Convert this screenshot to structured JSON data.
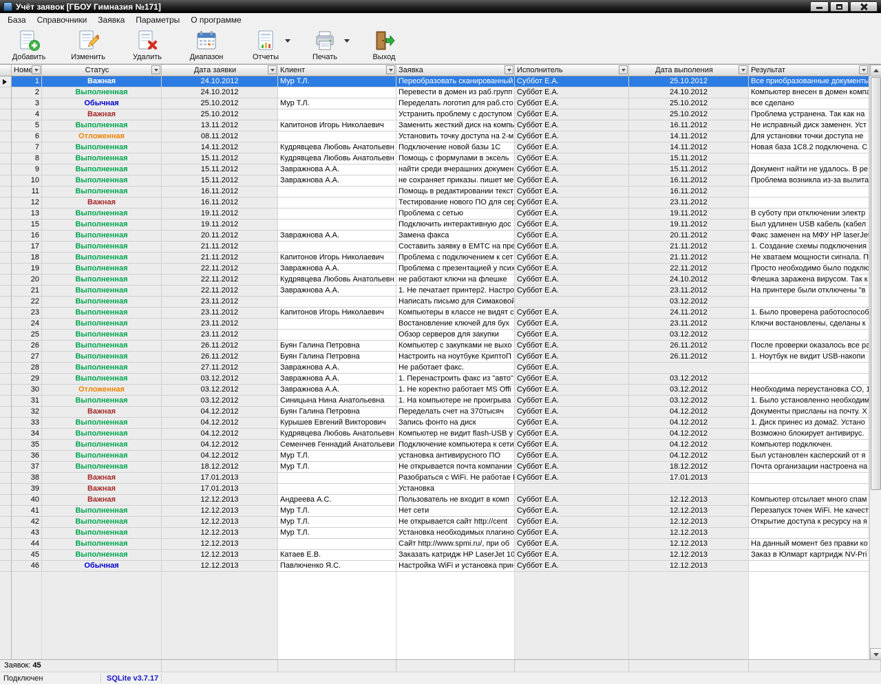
{
  "window": {
    "title": "Учёт заявок [ГБОУ Гимназия №171]"
  },
  "menu": [
    {
      "id": "db",
      "label": "База"
    },
    {
      "id": "references",
      "label": "Справочники"
    },
    {
      "id": "request",
      "label": "Заявка"
    },
    {
      "id": "parameters",
      "label": "Параметры"
    },
    {
      "id": "about",
      "label": "О программе"
    }
  ],
  "toolbar": [
    {
      "id": "add",
      "icon": "add-document",
      "label": "Добавить"
    },
    {
      "id": "edit",
      "icon": "edit-document",
      "label": "Изменить"
    },
    {
      "id": "delete",
      "icon": "delete-document",
      "label": "Удалить"
    },
    {
      "id": "range",
      "icon": "calendar-range",
      "label": "Диапазон"
    },
    {
      "id": "reports",
      "icon": "report-document",
      "label": "Отчеты",
      "dropdown": true
    },
    {
      "id": "print",
      "icon": "printer",
      "label": "Печать",
      "dropdown": true
    },
    {
      "id": "exit",
      "icon": "exit-door",
      "label": "Выход"
    }
  ],
  "colors": {
    "selection": "#2c7ce4",
    "db_version_text": "#1a17c9"
  },
  "status_colors": {
    "Важная": "#a52a2a",
    "Выполненная": "#00a651",
    "Обычная": "#0000cd",
    "Отложенная": "#ef8200"
  },
  "grid": {
    "selected_index": 0,
    "columns": [
      {
        "id": "number",
        "label": "Номер",
        "halign": "left"
      },
      {
        "id": "status",
        "label": "Статус",
        "halign": "center"
      },
      {
        "id": "request-date",
        "label": "Дата заявки",
        "halign": "center"
      },
      {
        "id": "client",
        "label": "Клиент",
        "halign": "left"
      },
      {
        "id": "request",
        "label": "Заявка",
        "halign": "left"
      },
      {
        "id": "executor",
        "label": "Исполнитель",
        "halign": "left"
      },
      {
        "id": "completion-date",
        "label": "Дата выполения",
        "halign": "center"
      },
      {
        "id": "result",
        "label": "Результат",
        "halign": "left"
      }
    ],
    "rows": [
      [
        "1",
        "Важная",
        "24.10.2012",
        "Мур Т.Л.",
        "Переобразовать сканированный",
        "Суббот Е.А.",
        "25.10.2012",
        "Все приобразованные документы"
      ],
      [
        "2",
        "Выполненная",
        "24.10.2012",
        "",
        "Перевести в домен из раб.групп",
        "Суббот Е.А.",
        "24.10.2012",
        "Компьютер внесен в домен компа"
      ],
      [
        "3",
        "Обычная",
        "25.10.2012",
        "Мур Т.Л.",
        "Переделать логотип для раб.сто",
        "Суббот Е.А.",
        "25.10.2012",
        "все сделано"
      ],
      [
        "4",
        "Важная",
        "25.10.2012",
        "",
        "Устранить проблему с доступом",
        "Суббот Е.А.",
        "25.10.2012",
        "Проблема устранена. Так как на"
      ],
      [
        "5",
        "Выполненная",
        "13.11.2012",
        "Капитонов Игорь Николаевич",
        "Заменить жесткий диск на компь",
        "Суббот Е.А.",
        "16.11.2012",
        "Не исправный диск заменен. Уст"
      ],
      [
        "6",
        "Отложенная",
        "08.11.2012",
        "",
        "Установить точку доступа на 2-м",
        "Суббот Е.А.",
        "14.11.2012",
        "Для установки точки доступа не"
      ],
      [
        "7",
        "Выполненная",
        "14.11.2012",
        "Кудрявцева Любовь Анатольевн",
        "Подключение новой базы 1С",
        "Суббот Е.А.",
        "14.11.2012",
        "Новая база 1С8.2 подключена. С"
      ],
      [
        "8",
        "Выполненная",
        "15.11.2012",
        "Кудрявцева Любовь Анатольевн",
        "Помощь с формулами в эксель",
        "Суббот Е.А.",
        "15.11.2012",
        ""
      ],
      [
        "9",
        "Выполненная",
        "15.11.2012",
        "Завражнова А.А.",
        "найти среди вчерашних докумен",
        "Суббот Е.А.",
        "15.11.2012",
        "Документ найти не удалось. В ре"
      ],
      [
        "10",
        "Выполненная",
        "15.11.2012",
        "Завражнова А.А.",
        "не сохраняет приказы. пишет ме",
        "Суббот Е.А.",
        "16.11.2012",
        "Проблема возникла из-за вылита"
      ],
      [
        "11",
        "Выполненная",
        "16.11.2012",
        "",
        "Помощь в редактировании текст",
        "Суббот Е.А.",
        "16.11.2012",
        ""
      ],
      [
        "12",
        "Важная",
        "16.11.2012",
        "",
        "Тестирование нового ПО для сер",
        "Суббот Е.А.",
        "23.11.2012",
        ""
      ],
      [
        "13",
        "Выполненная",
        "19.11.2012",
        "",
        "Проблема с сетью",
        "Суббот Е.А.",
        "19.11.2012",
        "В суботу при отключении электр"
      ],
      [
        "15",
        "Выполненная",
        "19.11.2012",
        "",
        "Подключить интерактивную дос",
        "Суббот Е.А.",
        "19.11.2012",
        "Был удлинен USB кабель (кабел"
      ],
      [
        "16",
        "Выполненная",
        "20.11.2012",
        "Завражнова А.А.",
        "Замена факса",
        "Суббот Е.А.",
        "20.11.2012",
        "Факс заменен на МФУ HP laserJet"
      ],
      [
        "17",
        "Выполненная",
        "21.11.2012",
        "",
        "Составить заявку в ЕМТС на пре",
        "Суббот Е.А.",
        "21.11.2012",
        "1. Создание схемы подключения"
      ],
      [
        "18",
        "Выполненная",
        "21.11.2012",
        "Капитонов Игорь Николаевич",
        "Проблема с подключением к сет",
        "Суббот Е.А.",
        "21.11.2012",
        "Не хватаем мощности сигнала. П"
      ],
      [
        "19",
        "Выполненная",
        "22.11.2012",
        "Завражнова А.А.",
        "Проблема с презентацией у псих",
        "Суббот Е.А.",
        "22.11.2012",
        "Просто необходимо было подклю"
      ],
      [
        "20",
        "Выполненная",
        "22.11.2012",
        "Кудрявцева Любовь Анатольевн",
        "не работают ключи на флешке",
        "Суббот Е.А.",
        "24.10.2012",
        "Флешка заражена вирусом. Так к"
      ],
      [
        "21",
        "Выполненная",
        "22.11.2012",
        "Завражнова А.А.",
        "1. Не печатает принтер2. Настро",
        "Суббот Е.А.",
        "23.11.2012",
        "На принтере были отключены \"в"
      ],
      [
        "22",
        "Выполненная",
        "23.11.2012",
        "",
        "Написать письмо для Симаковой",
        "",
        "03.12.2012",
        ""
      ],
      [
        "23",
        "Выполненная",
        "23.11.2012",
        "Капитонов Игорь Николаевич",
        "Компьютеры в классе не видят с",
        "Суббот Е.А.",
        "24.11.2012",
        "1. Было проверена работоспособ"
      ],
      [
        "24",
        "Выполненная",
        "23.11.2012",
        "",
        "Востановление ключей для бух",
        "Суббот Е.А.",
        "23.11.2012",
        "Ключи востановлены, сделаны к"
      ],
      [
        "25",
        "Выполненная",
        "23.11.2012",
        "",
        "Обзор серверов для закупки",
        "Суббот Е.А.",
        "03.12.2012",
        ""
      ],
      [
        "26",
        "Выполненная",
        "26.11.2012",
        "Буян Галина Петровна",
        "Компьютер с закупками не выхо",
        "Суббот Е.А.",
        "26.11.2012",
        "После проверки оказалось все ра"
      ],
      [
        "27",
        "Выполненная",
        "26.11.2012",
        "Буян Галина Петровна",
        "Настроить на ноутбуке КриптоП",
        "Суббот Е.А.",
        "26.11.2012",
        "1. Ноутбук не видит USB-накопи"
      ],
      [
        "28",
        "Выполненная",
        "27.11.2012",
        "Завражнова А.А.",
        "Не работает факс.",
        "Суббот Е.А.",
        "",
        ""
      ],
      [
        "29",
        "Выполненная",
        "03.12.2012",
        "Завражнова А.А.",
        "1. Перенастроить факс из \"авто\"",
        "Суббот Е.А.",
        "03.12.2012",
        ""
      ],
      [
        "30",
        "Отложенная",
        "03.12.2012",
        "Завражнова А.А.",
        "1. Не коректно работает MS Offi",
        "Суббот Е.А.",
        "03.12.2012",
        "Необходима переустановка СО, 1"
      ],
      [
        "31",
        "Выполненная",
        "03.12.2012",
        "Синицына Нина Анатольевна",
        "1. На компьютере не проигрыва",
        "Суббот Е.А.",
        "03.12.2012",
        "1. Было установленно необходим"
      ],
      [
        "32",
        "Важная",
        "04.12.2012",
        "Буян Галина Петровна",
        "Переделать счет на 370тысяч",
        "Суббот Е.А.",
        "04.12.2012",
        "Документы присланы на почту. Х"
      ],
      [
        "33",
        "Выполненная",
        "04.12.2012",
        "Курышев Евгений Викторович",
        "Запись фонто на диск",
        "Суббот Е.А.",
        "04.12.2012",
        "1. Диск принес из дома2. Устано"
      ],
      [
        "34",
        "Выполненная",
        "04.12.2012",
        "Кудрявцева Любовь Анатольевн",
        "Компьютер не видит flash-USB у",
        "Суббот Е.А.",
        "04.12.2012",
        "Возможно блокирует антивирус."
      ],
      [
        "35",
        "Выполненная",
        "04.12.2012",
        "Семенчев Геннадий Анатольеви",
        "Подключение компьютера к сети",
        "Суббот Е.А.",
        "04.12.2012",
        "Компьютер подключен."
      ],
      [
        "36",
        "Выполненная",
        "04.12.2012",
        "Мур Т.Л.",
        "установка антивирусного ПО",
        "Суббот Е.А.",
        "04.12.2012",
        "Был установлен касперский от я"
      ],
      [
        "37",
        "Выполненная",
        "18.12.2012",
        "Мур Т.Л.",
        "Не открывается почта компании",
        "Суббот Е.А.",
        "18.12.2012",
        "Почта организации настроена на"
      ],
      [
        "38",
        "Важная",
        "17.01.2013",
        "",
        "Разобраться с WiFi. Не работае Б",
        "Суббот Е.А.",
        "17.01.2013",
        ""
      ],
      [
        "39",
        "Важная",
        "17.01.2013",
        "",
        "Установка",
        "",
        "",
        ""
      ],
      [
        "40",
        "Важная",
        "12.12.2013",
        "Андреева А.С.",
        "Пользователь не входит в комп",
        "Суббот Е.А.",
        "12.12.2013",
        "Компьютер отсылает много спам"
      ],
      [
        "41",
        "Выполненная",
        "12.12.2013",
        "Мур Т.Л.",
        "Нет сети",
        "Суббот Е.А.",
        "12.12.2013",
        "Перезапуск точек WiFi. Не качест"
      ],
      [
        "42",
        "Выполненная",
        "12.12.2013",
        "Мур Т.Л.",
        "Не открывается сайт http://cent",
        "Суббот Е.А.",
        "12.12.2013",
        "Открытие доступа к ресурсу на я"
      ],
      [
        "43",
        "Выполненная",
        "12.12.2013",
        "Мур Т.Л.",
        "Установка необходимых плагино",
        "Суббот Е.А.",
        "12.12.2013",
        ""
      ],
      [
        "44",
        "Выполненная",
        "12.12.2013",
        "",
        "Сайт http://www.spmi.ru/, при об",
        "Суббот Е.А.",
        "12.12.2013",
        "На данный момент без правки ко"
      ],
      [
        "45",
        "Выполненная",
        "12.12.2013",
        "Катаев Е.В.",
        "Заказать катридж HP LaserJet 10",
        "Суббот Е.А.",
        "12.12.2013",
        "Заказ в Юлмарт картридж NV-Pri"
      ],
      [
        "46",
        "Обычная",
        "12.12.2013",
        "Павлюченко Я.С.",
        "Настройка WiFi и установка прин",
        "Суббот Е.А.",
        "12.12.2013",
        ""
      ]
    ]
  },
  "footer": {
    "label": "Заявок:",
    "count": "45"
  },
  "statusbar": {
    "connection": "Подключен",
    "db_version": "SQLite v3.7.17"
  }
}
